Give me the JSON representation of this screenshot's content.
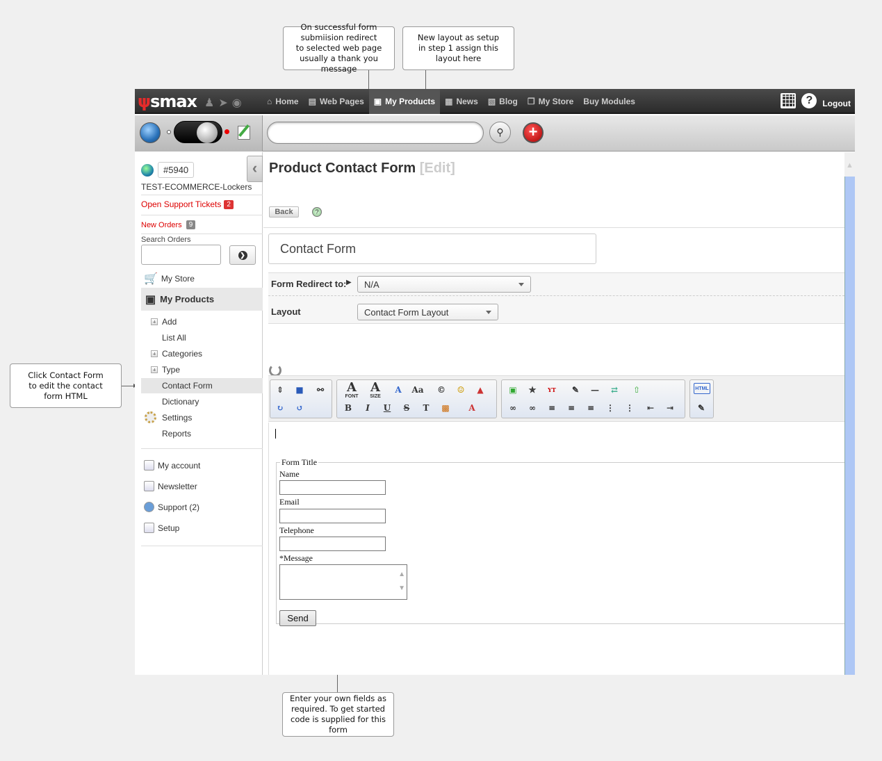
{
  "callouts": {
    "redirect": "On successful form\nsubmiision redirect\nto selected web page\nusually a thank you message",
    "layout": "New layout as setup\nin step 1 assign this\nlayout here",
    "contact_form": "Click Contact Form\nto edit the contact\nform HTML",
    "fields": "Enter your own fields as\nrequired. To get started\ncode is supplied for this form"
  },
  "topbar": {
    "logo": "smax",
    "nav": [
      "Home",
      "Web Pages",
      "My Products",
      "News",
      "Blog",
      "My Store",
      "Buy Modules"
    ],
    "active_nav": "My Products",
    "logout": "Logout"
  },
  "sidebar": {
    "site_id": "#5940",
    "site_name": "TEST-ECOMMERCE-Lockers",
    "open_tickets_label": "Open Support Tickets",
    "open_tickets_count": "2",
    "new_orders_label": "New Orders",
    "new_orders_count": "9",
    "search_orders_label": "Search Orders",
    "my_store": "My Store",
    "my_products": "My Products",
    "sub_items": [
      "Add",
      "List All",
      "Categories",
      "Type",
      "Contact Form",
      "Dictionary",
      "Settings",
      "Reports"
    ],
    "bottom_items": [
      "My account",
      "Newsletter",
      "Support (2)",
      "Setup"
    ]
  },
  "main": {
    "title": "Product Contact Form",
    "edit_link": "[Edit]",
    "back_label": "Back",
    "help_icon": "?",
    "name_value": "Contact Form",
    "redirect_label": "Form Redirect to:",
    "redirect_value": "N/A",
    "layout_label": "Layout",
    "layout_value": "Contact Form Layout"
  },
  "editor_toolbar": {
    "group1": [
      "page-icon",
      "save-icon",
      "find-icon",
      "redo-icon",
      "undo-icon"
    ],
    "font_label": "FONT",
    "size_label": "SIZE",
    "format_buttons": [
      "B",
      "I",
      "U",
      "S"
    ],
    "html_label": "HTML"
  },
  "form": {
    "legend": "Form Title",
    "name_label": "Name",
    "email_label": "Email",
    "telephone_label": "Telephone",
    "message_label": "*Message",
    "send_label": "Send"
  }
}
